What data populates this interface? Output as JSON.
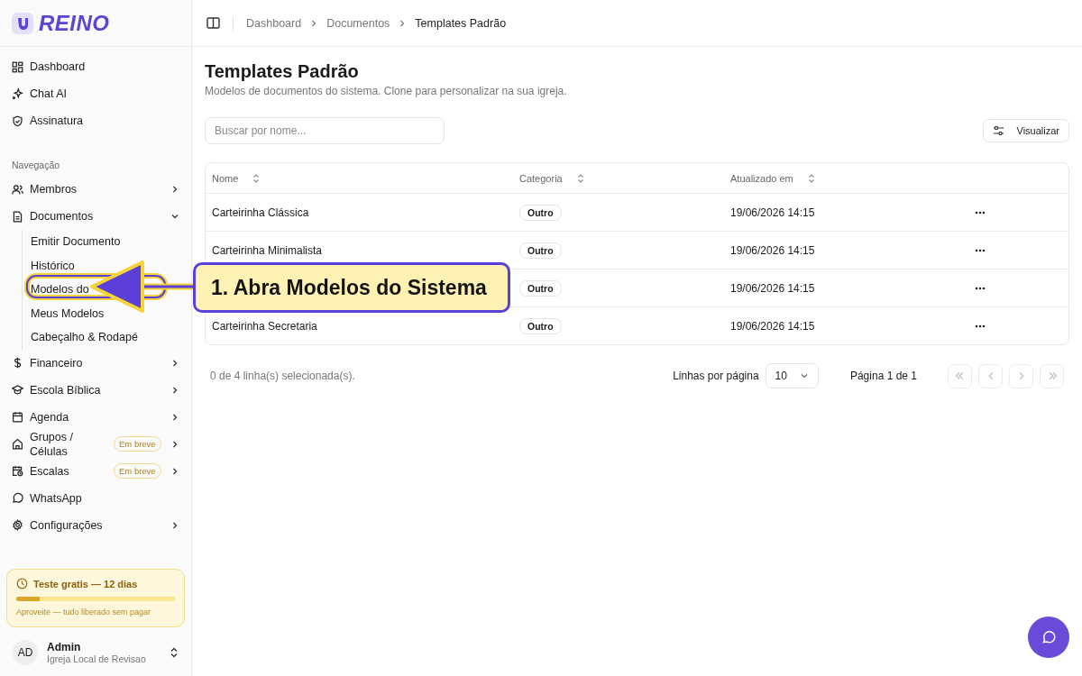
{
  "sidebar": {
    "logo": "REINO",
    "top_items": [
      {
        "label": "Dashboard"
      },
      {
        "label": "Chat AI"
      },
      {
        "label": "Assinatura"
      }
    ],
    "section_label": "Navegação",
    "items": [
      {
        "label": "Membros",
        "kind": "group",
        "expanded": false
      },
      {
        "label": "Documentos",
        "kind": "group",
        "expanded": true,
        "children": [
          {
            "label": "Emitir Documento"
          },
          {
            "label": "Histórico"
          },
          {
            "label": "Modelos do"
          },
          {
            "label": "Meus Modelos"
          },
          {
            "label": "Cabeçalho & Rodapé"
          }
        ]
      },
      {
        "label": "Financeiro",
        "kind": "group",
        "expanded": false
      },
      {
        "label": "Escola Bíblica",
        "kind": "group",
        "expanded": false
      },
      {
        "label": "Agenda",
        "kind": "group",
        "expanded": false
      },
      {
        "label": "Grupos / Células",
        "kind": "group",
        "expanded": false,
        "badge": "Em breve"
      },
      {
        "label": "Escalas",
        "kind": "group",
        "expanded": false,
        "badge": "Em breve"
      },
      {
        "label": "WhatsApp",
        "kind": "link"
      },
      {
        "label": "Configurações",
        "kind": "group",
        "expanded": false
      }
    ],
    "trial": {
      "title": "Teste gratis — 12 dias",
      "level": 0.15,
      "note": "Aproveite — tudo liberado sem pagar"
    },
    "user": {
      "initials": "AD",
      "name": "Admin",
      "org": "Igreja Local de Revisao"
    }
  },
  "breadcrumb": [
    "Dashboard",
    "Documentos",
    "Templates Padrão"
  ],
  "page": {
    "title": "Templates Padrão",
    "subtitle": "Modelos de documentos do sistema. Clone para personalizar na sua igreja."
  },
  "search": {
    "placeholder": "Buscar por nome..."
  },
  "view_button": "Visualizar",
  "table": {
    "columns": [
      "Nome",
      "Categoria",
      "Atualizado em"
    ],
    "rows": [
      {
        "name": "Carteirinha Clássica",
        "category": "Outro",
        "updated": "19/06/2026 14:15"
      },
      {
        "name": "Carteirinha Minimalista",
        "category": "Outro",
        "updated": "19/06/2026 14:15"
      },
      {
        "category": "Outro",
        "updated": "19/06/2026 14:15"
      },
      {
        "name": "Carteirinha Secretaria",
        "category": "Outro",
        "updated": "19/06/2026 14:15"
      }
    ]
  },
  "footer": {
    "selection": "0 de 4 linha(s) selecionada(s).",
    "rows_label": "Linhas por página",
    "rows_value": "10",
    "page_label": "Página 1 de 1",
    "buttons": [
      {
        "kind": "first",
        "disabled": true
      },
      {
        "kind": "prev",
        "disabled": true
      },
      {
        "kind": "next",
        "disabled": true
      },
      {
        "kind": "last",
        "disabled": true
      }
    ]
  },
  "callout": {
    "text": "1. Abra Modelos do Sistema"
  }
}
